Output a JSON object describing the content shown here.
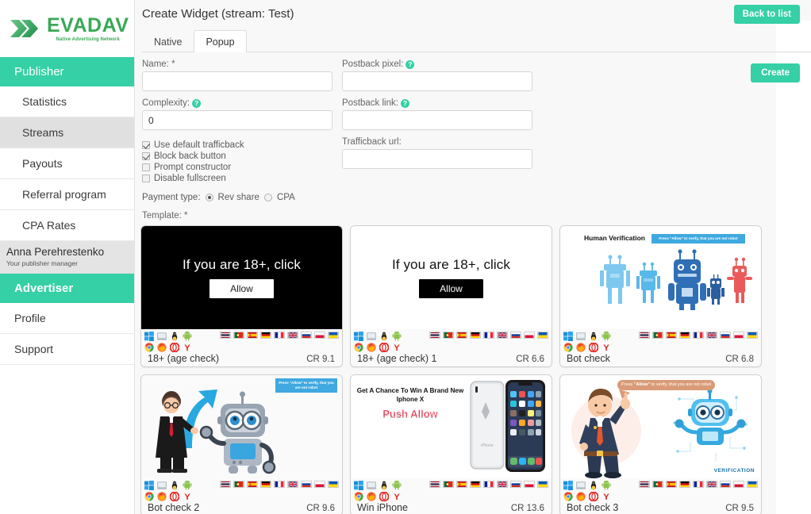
{
  "brand": {
    "name": "EVADAV",
    "tagline": "Native Advertising Network",
    "accent_green": "#35d0a5",
    "logo_green": "#3aa855"
  },
  "sidebar": {
    "publisher_header": "Publisher",
    "publisher_items": [
      {
        "label": "Statistics",
        "active": false
      },
      {
        "label": "Streams",
        "active": true
      },
      {
        "label": "Payouts",
        "active": false
      },
      {
        "label": "Referral program",
        "active": false
      },
      {
        "label": "CPA Rates",
        "active": false
      }
    ],
    "manager": {
      "name": "Anna Perehrestenko",
      "role": "Your publisher manager"
    },
    "advertiser_header": "Advertiser",
    "advertiser_items": [
      {
        "label": "Profile"
      },
      {
        "label": "Support"
      }
    ]
  },
  "header": {
    "title": "Create Widget (stream: Test)",
    "back_button": "Back to list"
  },
  "tabs": [
    {
      "label": "Native",
      "active": false
    },
    {
      "label": "Popup",
      "active": true
    }
  ],
  "form": {
    "create_button": "Create",
    "fields": {
      "name": {
        "label": "Name: *",
        "value": "",
        "placeholder": "",
        "help": false
      },
      "complexity": {
        "label": "Complexity:",
        "value": "0",
        "placeholder": "",
        "help": true
      },
      "postback_pixel": {
        "label": "Postback pixel:",
        "value": "",
        "placeholder": "",
        "help": true
      },
      "postback_link": {
        "label": "Postback link:",
        "value": "",
        "placeholder": "",
        "help": true
      },
      "trafficback_url": {
        "label": "Trafficback url:",
        "value": "",
        "placeholder": "",
        "help": false
      }
    },
    "checkboxes": [
      {
        "label": "Use default trafficback",
        "checked": true
      },
      {
        "label": "Block back button",
        "checked": true
      },
      {
        "label": "Prompt constructor",
        "checked": false
      },
      {
        "label": "Disable fullscreen",
        "checked": false
      }
    ],
    "payment_type": {
      "label": "Payment type:",
      "options": [
        {
          "label": "Rev share",
          "selected": true
        },
        {
          "label": "CPA",
          "selected": false
        }
      ]
    },
    "template_label": "Template: *"
  },
  "templates": [
    {
      "name": "18+ (age check)",
      "cr": "CR 9.1",
      "style": "dark",
      "headline": "If you are 18+, click",
      "button": "Allow"
    },
    {
      "name": "18+ (age check) 1",
      "cr": "CR 6.6",
      "style": "light",
      "headline": "If you are 18+, click",
      "button": "Allow"
    },
    {
      "name": "Bot check",
      "cr": "CR 6.8",
      "style": "botcheck",
      "title": "Human Verification",
      "badge": "Press \"Allow\" to verify, that you are not robot"
    },
    {
      "name": "Bot check 2",
      "cr": "CR 9.6",
      "style": "botcheck2",
      "badge": "Press \"Allow\" to verify, that you are not robot"
    },
    {
      "name": "Win iPhone",
      "cr": "CR 13.6",
      "style": "winiphone",
      "headline": "Get A Chance To Win A Brand New Iphone X",
      "subline": "Push Allow"
    },
    {
      "name": "Bot check 3",
      "cr": "CR 9.5",
      "style": "botcheck3",
      "speech_prefix": "Press ",
      "speech_quoted": "\"Allow\"",
      "speech_suffix": " to verify, that you are not robot",
      "watermark": "VERIFICATION"
    }
  ],
  "platform_icons": {
    "os": [
      "windows-icon",
      "macos-icon",
      "linux-icon",
      "android-icon"
    ],
    "browsers": [
      "chrome-icon",
      "firefox-icon",
      "opera-icon",
      "yandex-icon"
    ]
  },
  "country_flags": [
    "Thailand",
    "Portugal",
    "Spain",
    "Germany",
    "France",
    "United Kingdom",
    "Russia",
    "Poland",
    "Ukraine"
  ]
}
